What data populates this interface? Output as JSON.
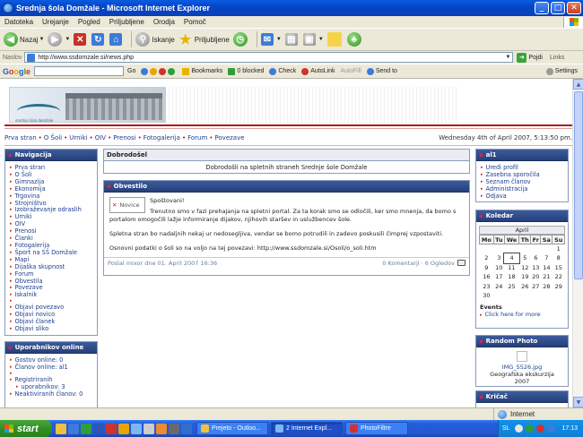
{
  "window": {
    "title": "Srednja šola Domžale - Microsoft Internet Explorer"
  },
  "menu": [
    "Datoteka",
    "Urejanje",
    "Pogled",
    "Priljubljene",
    "Orodja",
    "Pomoč"
  ],
  "toolbar": {
    "back_label": "Nazaj",
    "search_label": "Iskanje",
    "favorites_label": "Priljubljene"
  },
  "address": {
    "label": "Naslov",
    "url": "http://www.ssdomzale.si/news.php",
    "go_label": "Pojdi",
    "links_label": "Links"
  },
  "google_toolbar": {
    "logo": [
      "G",
      "o",
      "o",
      "g",
      "l",
      "e"
    ],
    "go_label": "Go",
    "bookmarks_label": "Bookmarks",
    "blocked_label": "0 blocked",
    "check_label": "Check",
    "autolink_label": "AutoLink",
    "autofill_label": "AutoFill",
    "sendto_label": "Send to",
    "settings_label": "Settings"
  },
  "site": {
    "banner_caption": "srednja šola domžale",
    "breadcrumb": [
      "Prva stran",
      "O Šoli",
      "Urniki",
      "OIV",
      "Prenosi",
      "Fotogalerija",
      "Forum",
      "Povezave"
    ],
    "date": "Wednesday 4th of April 2007, 5:13:50 pm.",
    "navigation": {
      "title": "Navigacija",
      "items": [
        "Prva stran",
        "O Šoli",
        "Gimnazija",
        "Ekonomija",
        "Trgovina",
        "Strojništvo",
        "Izobraževanje odraslih",
        "Urniki",
        "OIV",
        "Prenosi",
        "Članki",
        "Fotogalerija",
        "Šport na SŠ Domžale",
        "Mapi",
        "Dijaška skupnost",
        "Forum",
        "Obvestila",
        "Povezave",
        "Iskalnik"
      ],
      "submit_items": [
        "Objavi povezavo",
        "Objavi novico",
        "Objavi članek",
        "Objavi sliko"
      ]
    },
    "online": {
      "title": "Uporabnikov online",
      "lines": [
        "Gostov online: 0",
        "Članov online: al1"
      ],
      "lines2": [
        "Registriranih",
        "uporabnikov: 3",
        "Neaktiviranih članov: 0"
      ]
    },
    "welcome": {
      "title": "Dobrodošel",
      "text": "Dobrodošli na spletnih straneh Srednje šole Domžale"
    },
    "news": {
      "title": "Obvestilo",
      "avatar_label": "Novice",
      "greeting": "Spoštovani!",
      "p1": "Trenutno smo v fazi prehajanja na spletni portal. Za ta korak smo se odločili, ker smo mnenja, da bomo s portalom omogočili lažje informiranje dijakov, njihovih staršev in uslužbencev šole.",
      "p2": "Spletna stran bo nadaljnih nekaj ur nedosegljiva, vendar se bomo potrudili in zadevo poskusili čimprej vzpostaviti.",
      "p3": "Osnovni podatki o šoli so na voljo na tej povezavi: http://www.ssdomzale.si/Osoli/o_soli.htm",
      "posted_by": "Poslal mixor dne 01. April 2007 16:36",
      "stats": "0 Komentarji · 6 Ogledov"
    },
    "user_panel": {
      "title": "al1",
      "items": [
        "Uredi profil",
        "Zasebna sporočila",
        "Seznam članov",
        "Administracija",
        "Odjava"
      ]
    },
    "calendar": {
      "title": "Koledar",
      "month": "April",
      "weekdays": [
        "Mo",
        "Tu",
        "We",
        "Th",
        "Fr",
        "Sa",
        "Su"
      ],
      "weeks": [
        [
          "",
          "",
          "",
          "",
          "",
          "",
          "1"
        ],
        [
          "2",
          "3",
          "4",
          "5",
          "6",
          "7",
          "8"
        ],
        [
          "9",
          "10",
          "11",
          "12",
          "13",
          "14",
          "15"
        ],
        [
          "16",
          "17",
          "18",
          "19",
          "20",
          "21",
          "22"
        ],
        [
          "23",
          "24",
          "25",
          "26",
          "27",
          "28",
          "29"
        ],
        [
          "30",
          "",
          "",
          "",
          "",
          "",
          ""
        ]
      ],
      "today": "4",
      "events_title": "Events",
      "events_link": "Click here for more"
    },
    "photo": {
      "title": "Random Photo",
      "filename": "IMG_5526.jpg",
      "album_line1": "Geografska ekskurzija",
      "album_line2": "2007"
    },
    "kricac": {
      "title": "Kričač"
    }
  },
  "status": {
    "zone": "Internet"
  },
  "taskbar": {
    "start_label": "start",
    "tasks": [
      "Prejeto - Outloo...",
      "2 Internet Expl...",
      "PhotoFiltre"
    ],
    "lang": "SL",
    "clock": "17:13"
  }
}
